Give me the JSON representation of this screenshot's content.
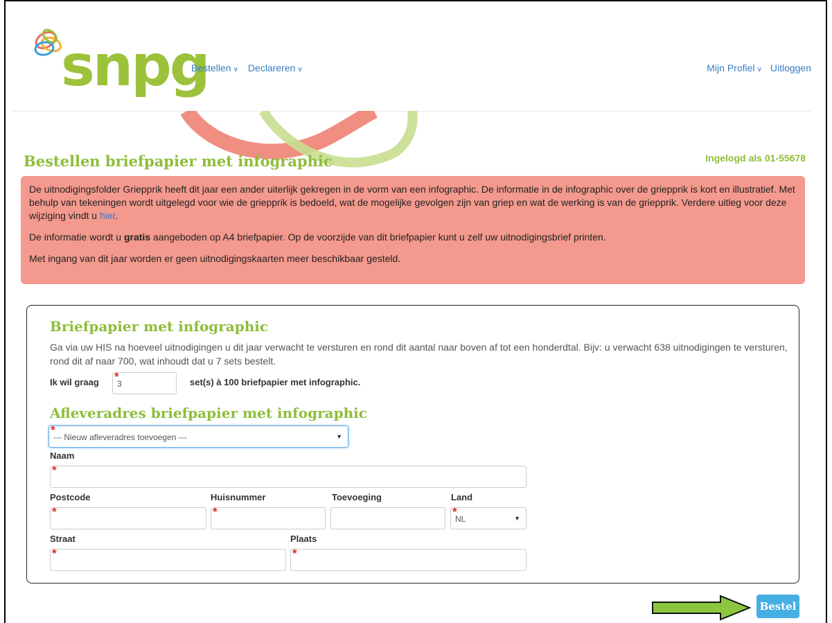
{
  "brand": {
    "name": "snpg"
  },
  "nav": {
    "bestellen": "Bestellen",
    "declareren": "Declareren",
    "profiel": "Mijn Profiel",
    "uitloggen": "Uitloggen"
  },
  "page": {
    "title": "Bestellen briefpapier met infographic",
    "logged_in": "Ingelogd als 01-55678"
  },
  "notice": {
    "p1_text": "De uitnodigingsfolder Griepprik heeft dit jaar een ander uiterlijk gekregen in de vorm van een infographic. De informatie in de infographic over de griepprik is kort en illustratief. Met behulp van tekeningen wordt uitgelegd voor wie de griepprik is bedoeld, wat de mogelijke gevolgen zijn van griep en wat de werking is van de griepprik. Verdere uitleg voor deze wijziging vindt u ",
    "p1_link": "hier",
    "p1_end": ".",
    "p2_before": "De informatie wordt u ",
    "p2_bold": "gratis",
    "p2_after": " aangeboden op A4 briefpapier. Op de voorzijde van dit briefpapier kunt u zelf uw uitnodigingsbrief printen.",
    "p3": "Met ingang van dit jaar worden er geen uitnodigingskaarten meer beschikbaar gesteld."
  },
  "form": {
    "section1_title": "Briefpapier met infographic",
    "section1_help": "Ga via uw HIS na hoeveel uitnodigingen u dit jaar verwacht te versturen en rond dit aantal naar boven af tot een honderdtal. Bijv: u verwacht 638 uitnodigingen te versturen, rond dit af naar 700, wat inhoudt dat u 7 sets bestelt.",
    "qty_label": "Ik wil graag",
    "qty_value": "3",
    "qty_suffix": "set(s) à 100 briefpapier met infographic.",
    "section2_title": "Afleveradres briefpapier met infographic",
    "address_select": "--- Nieuw afleveradres toevoegen ---",
    "naam_label": "Naam",
    "postcode_label": "Postcode",
    "huisnummer_label": "Huisnummer",
    "toevoeging_label": "Toevoeging",
    "land_label": "Land",
    "land_value": "NL",
    "straat_label": "Straat",
    "plaats_label": "Plaats",
    "required_mark": "*"
  },
  "actions": {
    "bestel": "Bestel"
  },
  "colors": {
    "brand_green": "#9cc13a",
    "notice_bg": "#f4998d",
    "button_blue": "#45aee2",
    "arrow_green": "#8cc63f"
  }
}
